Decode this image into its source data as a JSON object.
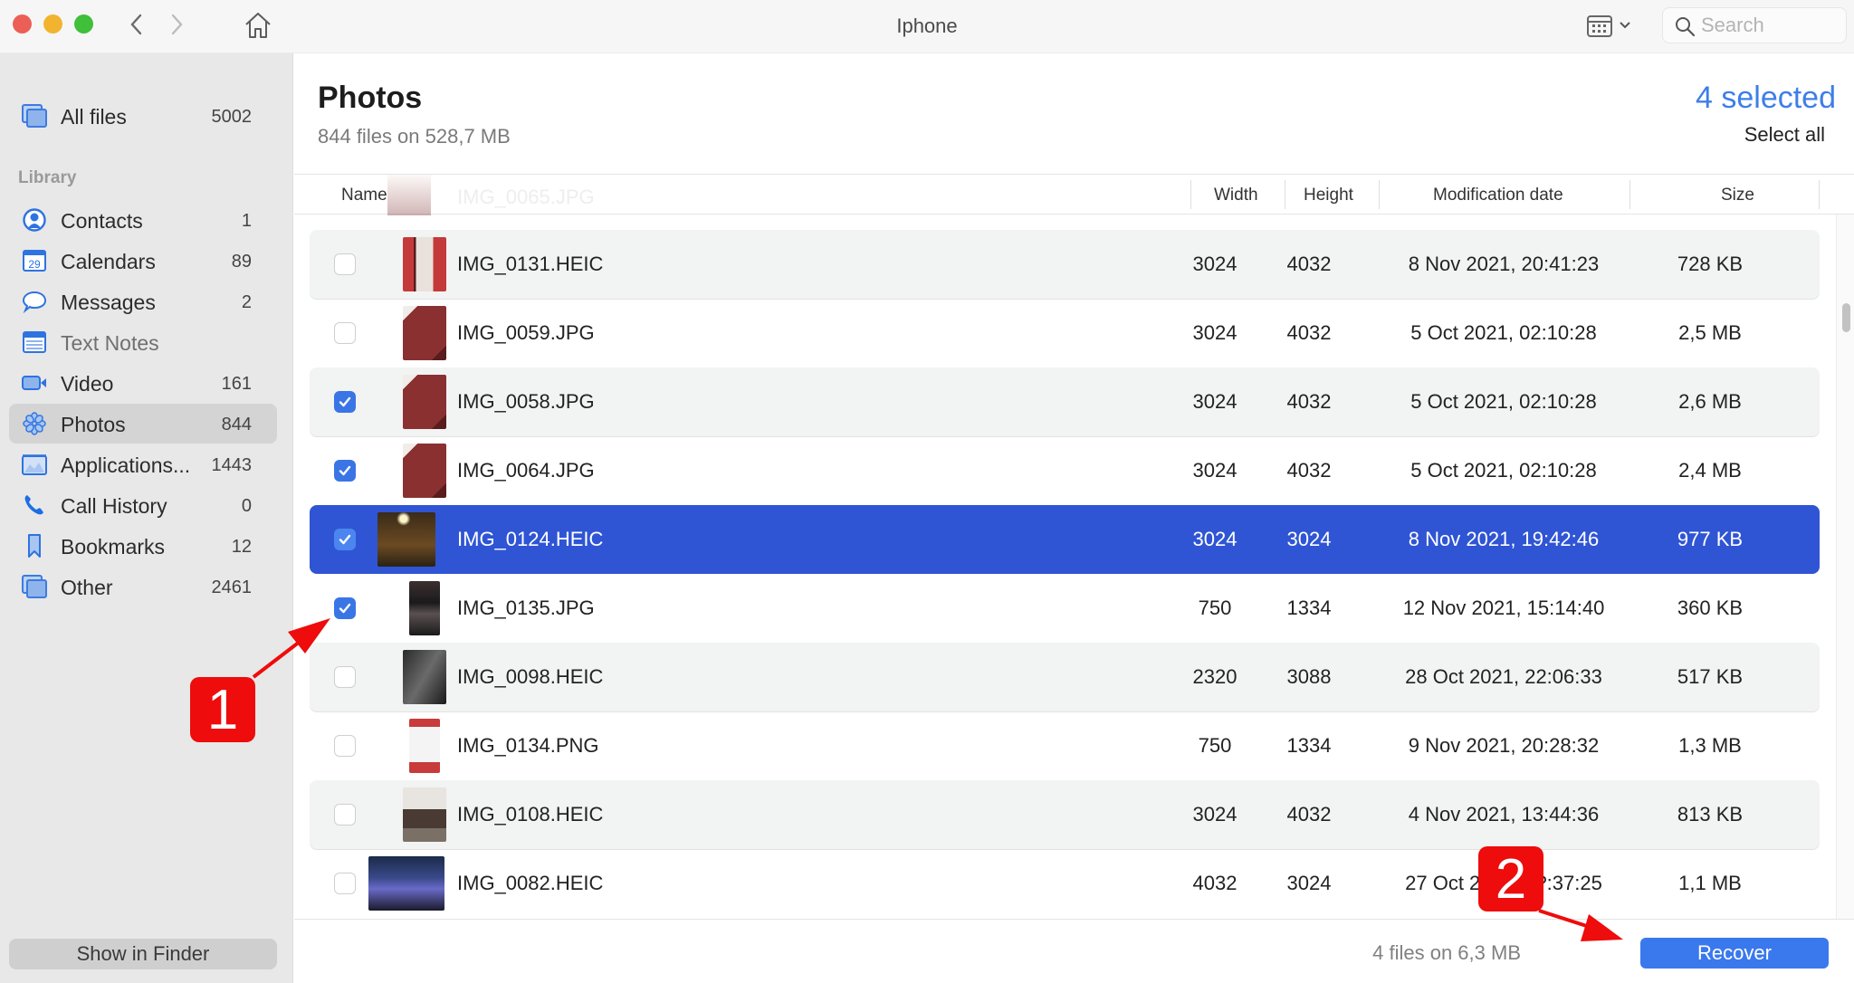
{
  "window": {
    "title": "Iphone",
    "search_placeholder": "Search",
    "search_value": ""
  },
  "sidebar": {
    "all_files": {
      "label": "All files",
      "count": "5002",
      "icon": "stack-icon"
    },
    "section_label": "Library",
    "items": [
      {
        "label": "Contacts",
        "count": "1",
        "icon": "contact-icon"
      },
      {
        "label": "Calendars",
        "count": "89",
        "icon": "calendar-icon"
      },
      {
        "label": "Messages",
        "count": "2",
        "icon": "message-icon"
      },
      {
        "label": "Text Notes",
        "count": "",
        "icon": "notes-icon"
      },
      {
        "label": "Video",
        "count": "161",
        "icon": "video-icon"
      },
      {
        "label": "Photos",
        "count": "844",
        "icon": "photos-icon",
        "active": true
      },
      {
        "label": "Applications...",
        "count": "1443",
        "icon": "applications-icon"
      },
      {
        "label": "Call History",
        "count": "0",
        "icon": "phone-icon"
      },
      {
        "label": "Bookmarks",
        "count": "12",
        "icon": "bookmark-icon"
      },
      {
        "label": "Other",
        "count": "2461",
        "icon": "stack-icon"
      }
    ],
    "show_in_finder": "Show in Finder"
  },
  "header": {
    "title": "Photos",
    "subtitle": "844 files on 528,7 MB",
    "selected": "4 selected",
    "select_all": "Select all"
  },
  "table": {
    "columns": {
      "name": "Name",
      "width": "Width",
      "height": "Height",
      "date": "Modification date",
      "size": "Size"
    },
    "ghost_row": {
      "name": "IMG_0065.JPG"
    },
    "rows": [
      {
        "name": "IMG_0131.HEIC",
        "width": "3024",
        "height": "4032",
        "date": "8 Nov 2021, 20:41:23",
        "size": "728 KB",
        "checked": false,
        "selected": false
      },
      {
        "name": "IMG_0059.JPG",
        "width": "3024",
        "height": "4032",
        "date": "5 Oct 2021, 02:10:28",
        "size": "2,5 MB",
        "checked": false,
        "selected": false
      },
      {
        "name": "IMG_0058.JPG",
        "width": "3024",
        "height": "4032",
        "date": "5 Oct 2021, 02:10:28",
        "size": "2,6 MB",
        "checked": true,
        "selected": false
      },
      {
        "name": "IMG_0064.JPG",
        "width": "3024",
        "height": "4032",
        "date": "5 Oct 2021, 02:10:28",
        "size": "2,4 MB",
        "checked": true,
        "selected": false
      },
      {
        "name": "IMG_0124.HEIC",
        "width": "3024",
        "height": "3024",
        "date": "8 Nov 2021, 19:42:46",
        "size": "977 KB",
        "checked": true,
        "selected": true
      },
      {
        "name": "IMG_0135.JPG",
        "width": "750",
        "height": "1334",
        "date": "12 Nov 2021, 15:14:40",
        "size": "360 KB",
        "checked": true,
        "selected": false
      },
      {
        "name": "IMG_0098.HEIC",
        "width": "2320",
        "height": "3088",
        "date": "28 Oct 2021, 22:06:33",
        "size": "517 KB",
        "checked": false,
        "selected": false
      },
      {
        "name": "IMG_0134.PNG",
        "width": "750",
        "height": "1334",
        "date": "9 Nov 2021, 20:28:32",
        "size": "1,3 MB",
        "checked": false,
        "selected": false
      },
      {
        "name": "IMG_0108.HEIC",
        "width": "3024",
        "height": "4032",
        "date": "4 Nov 2021, 13:44:36",
        "size": "813 KB",
        "checked": false,
        "selected": false
      },
      {
        "name": "IMG_0082.HEIC",
        "width": "4032",
        "height": "3024",
        "date": "27 Oct 2021, ??:37:25",
        "size": "1,1 MB",
        "checked": false,
        "selected": false
      }
    ]
  },
  "footer": {
    "summary": "4 files on 6,3 MB",
    "recover": "Recover"
  },
  "annotations": [
    {
      "label": "1",
      "points_to": "IMG_0135.JPG checkbox"
    },
    {
      "label": "2",
      "points_to": "Recover button"
    }
  ],
  "colors": {
    "accent": "#3a78ee",
    "selection": "#2f55d4",
    "annotation": "#ee0c0c"
  }
}
